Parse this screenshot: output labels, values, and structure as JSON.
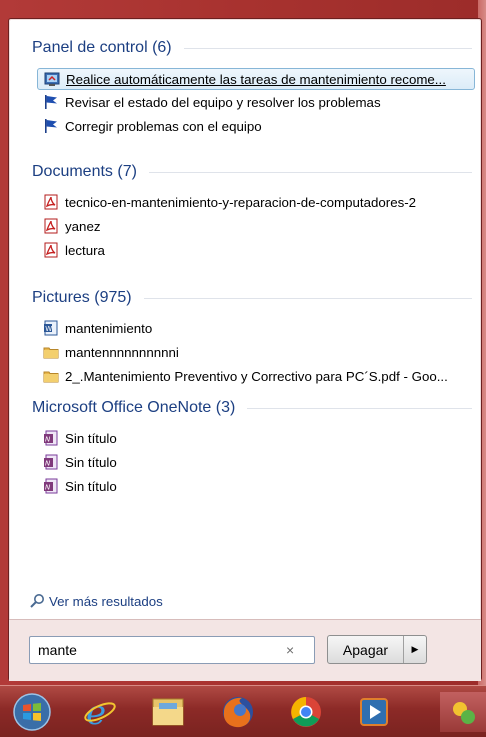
{
  "groups": {
    "control_panel": {
      "title": "Panel de control (6)",
      "items": [
        {
          "label": "Realice automáticamente las tareas de mantenimiento recome...",
          "icon": "maintenance-icon"
        },
        {
          "label": "Revisar el estado del equipo y resolver los problemas",
          "icon": "flag-icon"
        },
        {
          "label": "Corregir problemas con el equipo",
          "icon": "flag-icon"
        }
      ]
    },
    "documents": {
      "title": "Documents (7)",
      "items": [
        {
          "label": "tecnico-en-mantenimiento-y-reparacion-de-computadores-2",
          "icon": "pdf-icon"
        },
        {
          "label": "yanez",
          "icon": "pdf-icon"
        },
        {
          "label": "lectura",
          "icon": "pdf-icon"
        }
      ]
    },
    "pictures": {
      "title": "Pictures (975)",
      "items": [
        {
          "label": "mantenimiento",
          "icon": "word-doc-icon"
        },
        {
          "label": "mantennnnnnnnnni",
          "icon": "folder-icon"
        },
        {
          "label": "2_.Mantenimiento Preventivo y Correctivo para PC´S.pdf - Goo...",
          "icon": "folder-icon"
        }
      ]
    },
    "onenote": {
      "title": "Microsoft Office OneNote (3)",
      "items": [
        {
          "label": "Sin título",
          "icon": "onenote-icon"
        },
        {
          "label": "Sin título",
          "icon": "onenote-icon"
        },
        {
          "label": "Sin título",
          "icon": "onenote-icon"
        }
      ]
    }
  },
  "more_results": "Ver más resultados",
  "search": {
    "value": "mante",
    "clear": "×"
  },
  "shutdown": {
    "label": "Apagar",
    "arrow": "▶"
  },
  "taskbar": {
    "items": [
      "start-orb-icon",
      "internet-explorer-icon",
      "file-explorer-icon",
      "firefox-icon",
      "chrome-icon",
      "media-player-icon",
      "app-icon"
    ]
  },
  "colors": {
    "frame": "#a8322f",
    "group_title": "#1c3f82",
    "selected_bg": "#dcecf8",
    "selected_border": "#87b6d7"
  }
}
